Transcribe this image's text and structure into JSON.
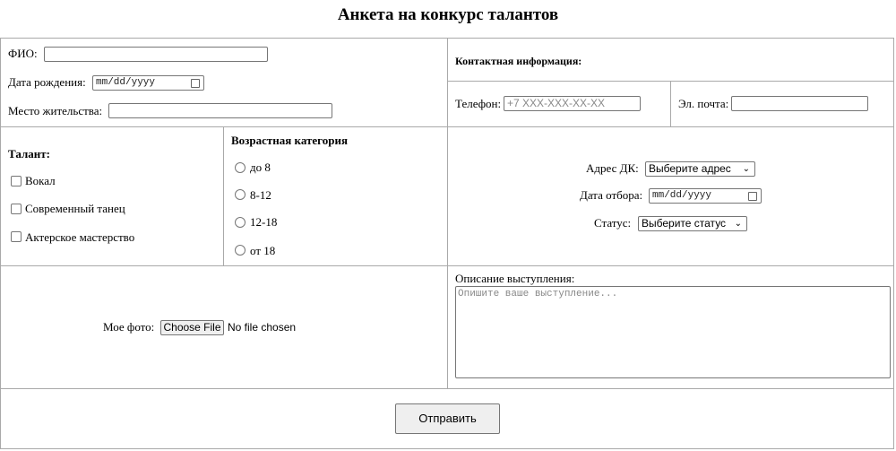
{
  "title": "Анкета на конкурс талантов",
  "personal": {
    "fio_label": "ФИО:",
    "birth_label": "Дата рождения:",
    "birth_placeholder": "mm/dd/yyyy",
    "residence_label": "Место жительства:"
  },
  "contact": {
    "heading": "Контактная информация:",
    "phone_label": "Телефон:",
    "phone_placeholder": "+7 XXX-XXX-XX-XX",
    "email_label": "Эл. почта:"
  },
  "talent": {
    "heading": "Талант:",
    "options": [
      "Вокал",
      "Современный танец",
      "Актерское мастерство"
    ]
  },
  "age": {
    "heading": "Возрастная категория",
    "options": [
      "до 8",
      "8-12",
      "12-18",
      "от 18"
    ]
  },
  "venue": {
    "address_label": "Адрес ДК:",
    "address_value": "Выберите адрес",
    "date_label": "Дата отбора:",
    "date_placeholder": "mm/dd/yyyy",
    "status_label": "Статус:",
    "status_value": "Выберите статус"
  },
  "photo": {
    "label": "Мое фото:",
    "button": "Choose File",
    "status": "No file chosen"
  },
  "description": {
    "label": "Описание выступления:",
    "placeholder": "Опишите ваше выступление..."
  },
  "submit": "Отправить"
}
